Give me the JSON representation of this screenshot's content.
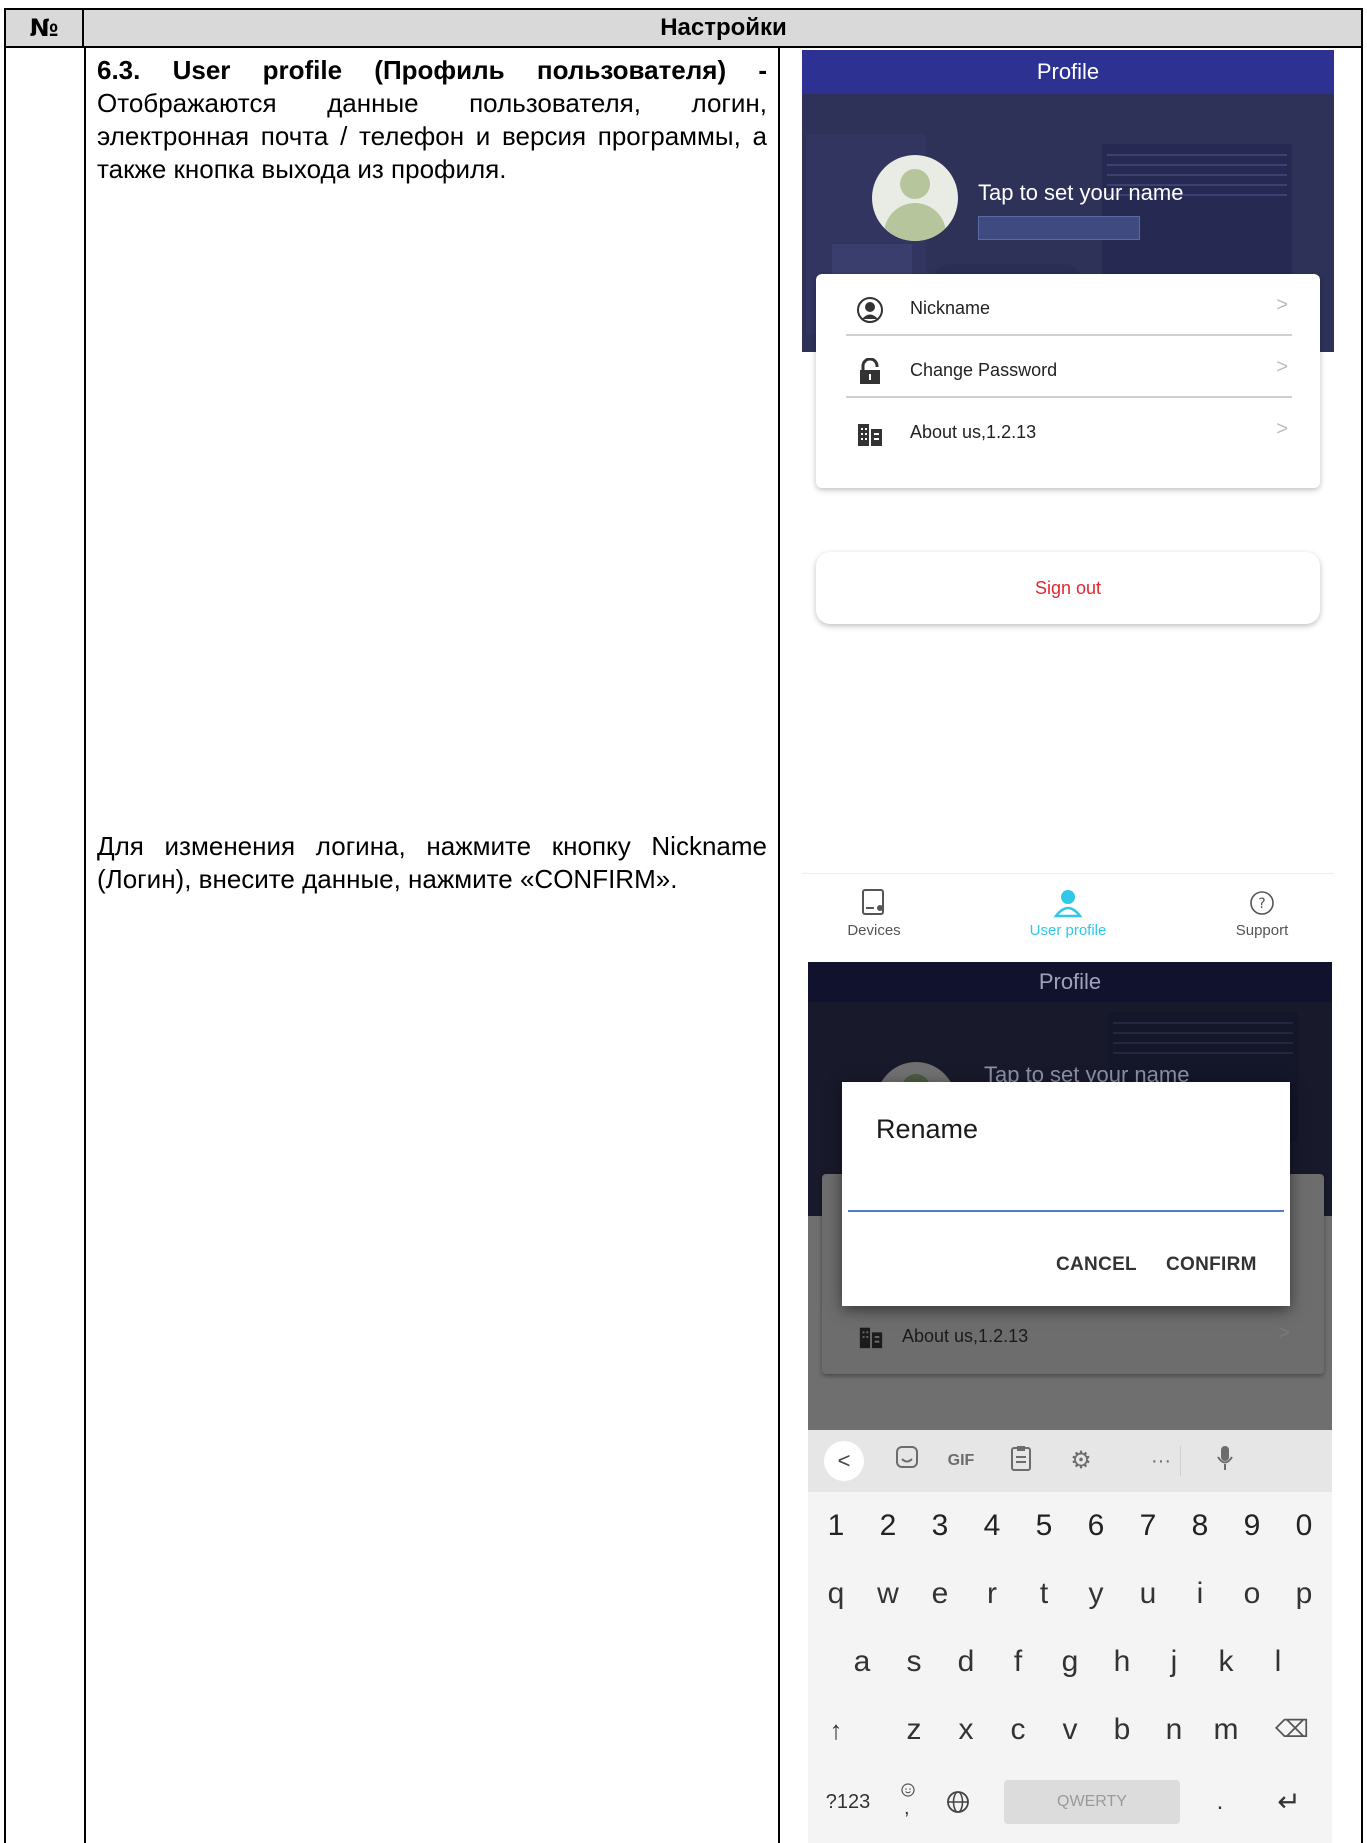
{
  "table": {
    "header_num": "№",
    "header_title": "Настройки"
  },
  "section1": {
    "heading": "6.3. User profile (Профиль пользователя) -",
    "body": "Отображаются данные пользователя, логин, электронная почта / телефон и версия программы, а также кнопка выхода из профиля."
  },
  "section2": {
    "body": "Для изменения логина, нажмите кнопку Nickname (Логин), внесите данные, нажмите «CONFIRM»."
  },
  "phone1": {
    "appbar_title": "Profile",
    "set_name_prompt": "Tap to set your name",
    "menu": [
      {
        "label": "Nickname",
        "icon": "person-icon"
      },
      {
        "label": "Change Password",
        "icon": "lock-icon"
      },
      {
        "label": "About us,1.2.13",
        "icon": "building-icon"
      }
    ],
    "chevron": ">",
    "sign_out": "Sign out",
    "tabs": [
      {
        "label": "Devices",
        "icon": "devices-icon"
      },
      {
        "label": "User profile",
        "icon": "user-icon",
        "active": true
      },
      {
        "label": "Support",
        "icon": "help-icon"
      }
    ],
    "colors": {
      "appbar": "#2c3192",
      "sign_out": "#e0282e",
      "active_tab": "#2fc8e8"
    }
  },
  "phone2": {
    "appbar_title": "Profile",
    "set_name_prompt": "Tap to set your name",
    "about_label": "About us,1.2.13",
    "chevron": ">",
    "dialog": {
      "title": "Rename",
      "input_value": "",
      "cancel": "CANCEL",
      "confirm": "CONFIRM"
    },
    "keyboard": {
      "toolbar": {
        "back": "<",
        "gif": "GIF",
        "more": "···"
      },
      "numbers": [
        "1",
        "2",
        "3",
        "4",
        "5",
        "6",
        "7",
        "8",
        "9",
        "0"
      ],
      "row1": [
        "q",
        "w",
        "e",
        "r",
        "t",
        "y",
        "u",
        "i",
        "o",
        "p"
      ],
      "row2": [
        "a",
        "s",
        "d",
        "f",
        "g",
        "h",
        "j",
        "k",
        "l"
      ],
      "row3": [
        "z",
        "x",
        "c",
        "v",
        "b",
        "n",
        "m"
      ],
      "shift": "↑",
      "backspace": "⌫",
      "symbols": "?123",
      "emoji_comma": ",",
      "space": "QWERTY",
      "period": ".",
      "enter": "↵"
    }
  }
}
